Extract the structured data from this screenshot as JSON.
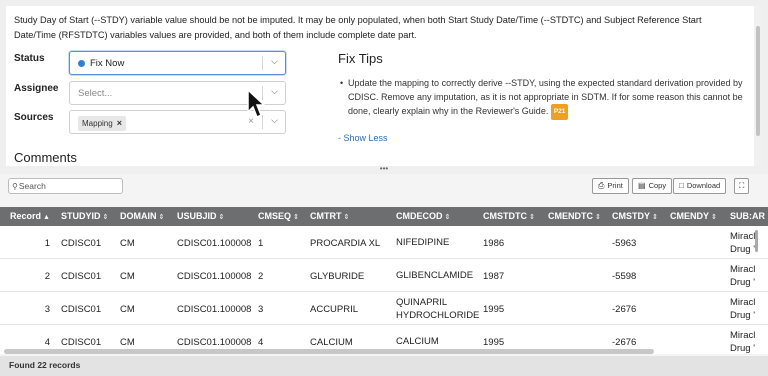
{
  "issue": {
    "description": "Study Day of Start (--STDY) variable value should be not be imputed. It may be only populated, when both Start Study Date/Time (--STDTC) and Subject Reference Start Date/Time (RFSTDTC) variables values are provided, and both of them include complete date part."
  },
  "form": {
    "status_label": "Status",
    "status_value": "Fix Now",
    "status_color": "#2e7fd6",
    "assignee_label": "Assignee",
    "assignee_placeholder": "Select...",
    "sources_label": "Sources",
    "sources_chip": "Mapping",
    "chip_remove": "×",
    "clear_symbol": "×"
  },
  "fix_tips": {
    "title": "Fix Tips",
    "body": "Update the mapping to correctly derive --STDY, using the expected standard derivation provided by CDISC. Remove any imputation, as it is not appropriate in SDTM. If for some reason this cannot be done, clearly explain why in the Reviewer's Guide.",
    "badge": "P21",
    "badge_color": "#f0a020",
    "show_less": "- Show Less"
  },
  "comments": {
    "title": "Comments"
  },
  "splitter_handle": "•••",
  "toolbar": {
    "search_placeholder": "Search",
    "print_label": "Print",
    "copy_label": "Copy",
    "download_label": "Download",
    "expand_icon": "fullscreen-icon"
  },
  "table": {
    "columns": [
      "Record",
      "STUDYID",
      "DOMAIN",
      "USUBJID",
      "CMSEQ",
      "CMTRT",
      "CMDECOD",
      "CMSTDTC",
      "CMENDTC",
      "CMSTDY",
      "CMENDY",
      "SUB:AR"
    ],
    "sort_asc": "▲",
    "sort_both": "⇕",
    "rows": [
      {
        "record": "1",
        "studyid": "CDISC01",
        "domain": "CM",
        "usubjid": "CDISC01.100008",
        "cmseq": "1",
        "cmtrt": "PROCARDIA XL",
        "cmdecod": [
          "NIFEDIPINE"
        ],
        "cmstdtc": "1986",
        "cmendtc": "",
        "cmstdy": "-5963",
        "cmendy": "",
        "sub": [
          "Miracl",
          "Drug '"
        ]
      },
      {
        "record": "2",
        "studyid": "CDISC01",
        "domain": "CM",
        "usubjid": "CDISC01.100008",
        "cmseq": "2",
        "cmtrt": "GLYBURIDE",
        "cmdecod": [
          "GLIBENCLAMIDE"
        ],
        "cmstdtc": "1987",
        "cmendtc": "",
        "cmstdy": "-5598",
        "cmendy": "",
        "sub": [
          "Miracl",
          "Drug '"
        ]
      },
      {
        "record": "3",
        "studyid": "CDISC01",
        "domain": "CM",
        "usubjid": "CDISC01.100008",
        "cmseq": "3",
        "cmtrt": "ACCUPRIL",
        "cmdecod": [
          "QUINAPRIL",
          "HYDROCHLORIDE"
        ],
        "cmstdtc": "1995",
        "cmendtc": "",
        "cmstdy": "-2676",
        "cmendy": "",
        "sub": [
          "Miracl",
          "Drug '"
        ]
      },
      {
        "record": "4",
        "studyid": "CDISC01",
        "domain": "CM",
        "usubjid": "CDISC01.100008",
        "cmseq": "4",
        "cmtrt": "CALCIUM",
        "cmdecod": [
          "CALCIUM"
        ],
        "cmstdtc": "1995",
        "cmendtc": "",
        "cmstdy": "-2676",
        "cmendy": "",
        "sub": [
          "Miracl",
          "Drug '"
        ]
      }
    ]
  },
  "footer": {
    "text": "Found 22 records"
  }
}
